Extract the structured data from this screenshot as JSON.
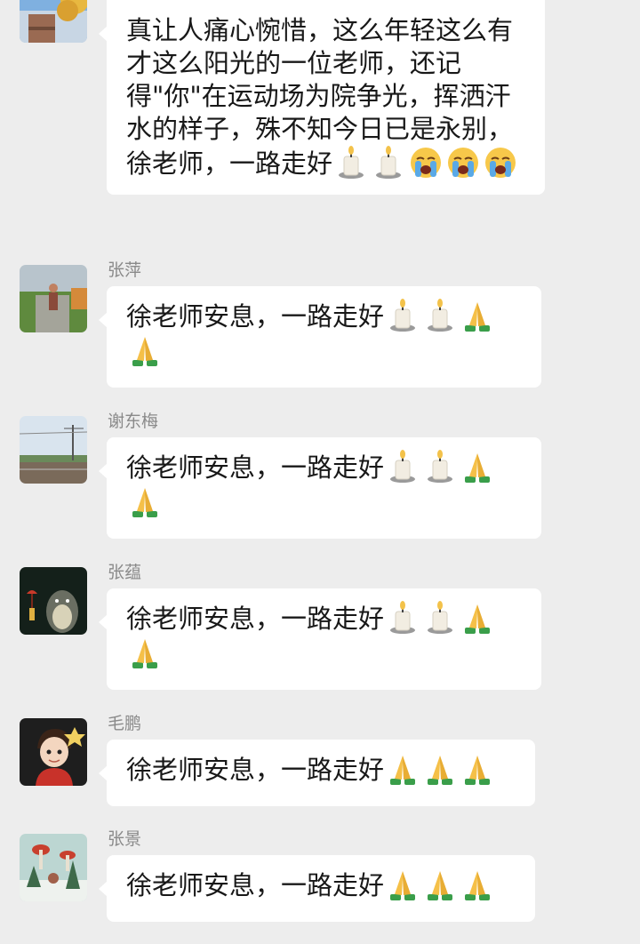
{
  "messages": [
    {
      "sender": "",
      "text": "真让人痛心惋惜，这么年轻这么有才这么阳光的一位老师，还记得\"你\"在运动场为院争光，挥洒汗水的样子，殊不知今日已是永别，徐老师，一路走好",
      "emojis": [
        "candle-icon",
        "candle-icon",
        "crying-face-icon",
        "crying-face-icon",
        "crying-face-icon"
      ]
    },
    {
      "sender": "张萍",
      "text": "徐老师安息，一路走好",
      "emojis": [
        "candle-icon",
        "candle-icon",
        "folded-hands-icon",
        "folded-hands-icon"
      ]
    },
    {
      "sender": "谢东梅",
      "text": "徐老师安息，一路走好",
      "emojis": [
        "candle-icon",
        "candle-icon",
        "folded-hands-icon",
        "folded-hands-icon"
      ]
    },
    {
      "sender": "张蕴",
      "text": "徐老师安息，一路走好",
      "emojis": [
        "candle-icon",
        "candle-icon",
        "folded-hands-icon",
        "folded-hands-icon"
      ]
    },
    {
      "sender": "毛鹏",
      "text": "徐老师安息，一路走好",
      "emojis": [
        "folded-hands-icon",
        "folded-hands-icon",
        "folded-hands-icon"
      ]
    },
    {
      "sender": "张景",
      "text": "徐老师安息，一路走好",
      "emojis": [
        "folded-hands-icon",
        "folded-hands-icon",
        "folded-hands-icon"
      ]
    }
  ],
  "colors": {
    "background": "#ededed",
    "bubble": "#ffffff",
    "sender_name": "#8a8a8a",
    "message_text": "#181818"
  }
}
